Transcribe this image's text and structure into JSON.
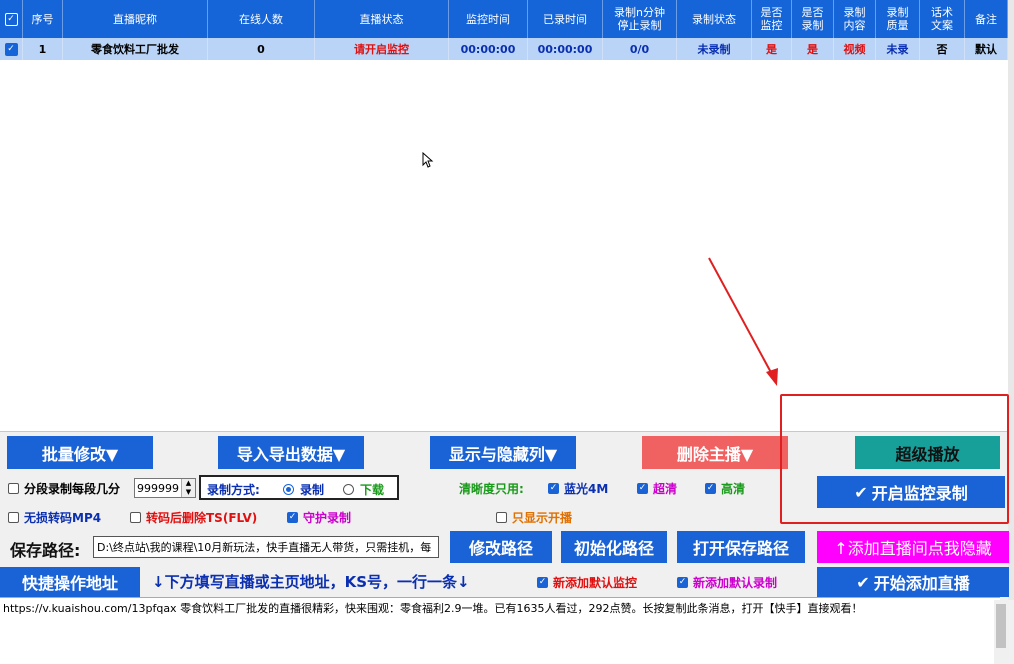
{
  "table": {
    "headers": [
      "序号",
      "直播昵称",
      "在线人数",
      "直播状态",
      "监控时间",
      "已录时间",
      "录制n分钟\n停止录制",
      "录制状态",
      "是否\n监控",
      "是否\n录制",
      "录制\n内容",
      "录制\n质量",
      "话术\n文案",
      "备注"
    ],
    "rows": [
      {
        "index": "1",
        "name": "零食饮料工厂批发",
        "online": "0",
        "live_status": "请开启监控",
        "monitor_time": "00:00:00",
        "recorded_time": "00:00:00",
        "stop_after": "0/0",
        "record_status": "未录制",
        "is_monitor": "是",
        "is_record": "是",
        "content": "视频",
        "quality": "未录",
        "script": "否",
        "note": "默认"
      }
    ]
  },
  "toolbar": {
    "batch_edit": "批量修改▼",
    "import_export": "导入导出数据▼",
    "show_hide_cols": "显示与隐藏列▼",
    "delete_anchor": "删除主播▼",
    "super_play": "超级播放"
  },
  "options": {
    "segment_label": "分段录制每段几分",
    "segment_value": "999999",
    "record_mode_label": "录制方式:",
    "mode_record": "录制",
    "mode_download": "下载",
    "clarity_label": "清晰度只用:",
    "blueray": "蓝光4M",
    "super_hd": "超清",
    "hd": "高清",
    "lossless": "无损转码MP4",
    "delete_ts": "转码后删除TS(FLV)",
    "guard_record": "守护录制",
    "only_live": "只显示开播",
    "start_monitor": "开启监控录制"
  },
  "path": {
    "label": "保存路径:",
    "value": "D:\\终点站\\我的课程\\10月新玩法，快手直播无人带货，只需挂机，每",
    "modify": "修改路径",
    "init": "初始化路径",
    "open": "打开保存路径",
    "hide_add": "↑添加直播间点我隐藏"
  },
  "quick": {
    "label": "快捷操作地址",
    "hint": "↓下方填写直播或主页地址，KS号，一行一条↓",
    "default_monitor": "新添加默认监控",
    "default_record": "新添加默认录制",
    "start_add": "开始添加直播"
  },
  "url_text": "https://v.kuaishou.com/13pfqax 零食饮料工厂批发的直播很精彩，快来围观：零食福利2.9一堆。已有1635人看过，292点赞。长按复制此条消息，打开【快手】直接观看！",
  "colors": {
    "accent": "#1a63d6",
    "red_button": "#f06262",
    "teal": "#179f9a",
    "magenta": "#ff00ff",
    "highlight": "#e02020"
  }
}
